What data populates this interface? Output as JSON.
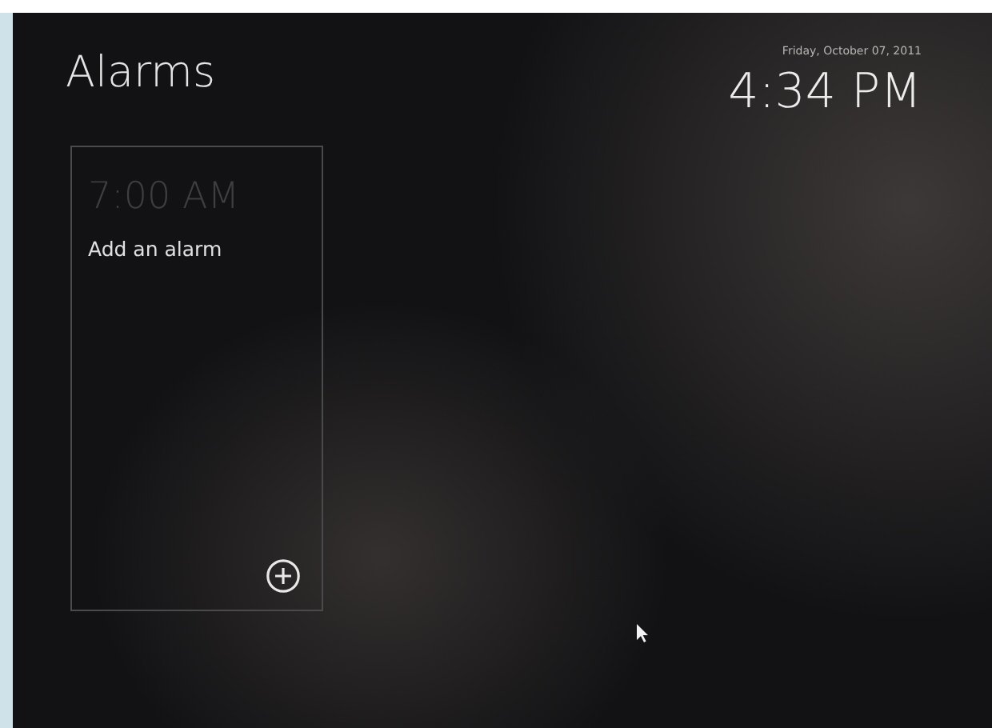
{
  "header": {
    "title": "Alarms",
    "date": "Friday, October 07, 2011",
    "time": "4:34 PM"
  },
  "alarm_card": {
    "time_placeholder": "7:00 AM",
    "label": "Add an alarm"
  }
}
